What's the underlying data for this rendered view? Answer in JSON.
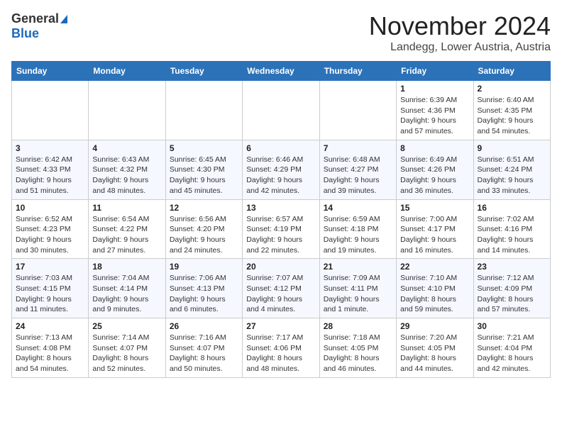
{
  "header": {
    "logo_general": "General",
    "logo_blue": "Blue",
    "month": "November 2024",
    "location": "Landegg, Lower Austria, Austria"
  },
  "weekdays": [
    "Sunday",
    "Monday",
    "Tuesday",
    "Wednesday",
    "Thursday",
    "Friday",
    "Saturday"
  ],
  "weeks": [
    [
      {
        "day": "",
        "info": ""
      },
      {
        "day": "",
        "info": ""
      },
      {
        "day": "",
        "info": ""
      },
      {
        "day": "",
        "info": ""
      },
      {
        "day": "",
        "info": ""
      },
      {
        "day": "1",
        "info": "Sunrise: 6:39 AM\nSunset: 4:36 PM\nDaylight: 9 hours and 57 minutes."
      },
      {
        "day": "2",
        "info": "Sunrise: 6:40 AM\nSunset: 4:35 PM\nDaylight: 9 hours and 54 minutes."
      }
    ],
    [
      {
        "day": "3",
        "info": "Sunrise: 6:42 AM\nSunset: 4:33 PM\nDaylight: 9 hours and 51 minutes."
      },
      {
        "day": "4",
        "info": "Sunrise: 6:43 AM\nSunset: 4:32 PM\nDaylight: 9 hours and 48 minutes."
      },
      {
        "day": "5",
        "info": "Sunrise: 6:45 AM\nSunset: 4:30 PM\nDaylight: 9 hours and 45 minutes."
      },
      {
        "day": "6",
        "info": "Sunrise: 6:46 AM\nSunset: 4:29 PM\nDaylight: 9 hours and 42 minutes."
      },
      {
        "day": "7",
        "info": "Sunrise: 6:48 AM\nSunset: 4:27 PM\nDaylight: 9 hours and 39 minutes."
      },
      {
        "day": "8",
        "info": "Sunrise: 6:49 AM\nSunset: 4:26 PM\nDaylight: 9 hours and 36 minutes."
      },
      {
        "day": "9",
        "info": "Sunrise: 6:51 AM\nSunset: 4:24 PM\nDaylight: 9 hours and 33 minutes."
      }
    ],
    [
      {
        "day": "10",
        "info": "Sunrise: 6:52 AM\nSunset: 4:23 PM\nDaylight: 9 hours and 30 minutes."
      },
      {
        "day": "11",
        "info": "Sunrise: 6:54 AM\nSunset: 4:22 PM\nDaylight: 9 hours and 27 minutes."
      },
      {
        "day": "12",
        "info": "Sunrise: 6:56 AM\nSunset: 4:20 PM\nDaylight: 9 hours and 24 minutes."
      },
      {
        "day": "13",
        "info": "Sunrise: 6:57 AM\nSunset: 4:19 PM\nDaylight: 9 hours and 22 minutes."
      },
      {
        "day": "14",
        "info": "Sunrise: 6:59 AM\nSunset: 4:18 PM\nDaylight: 9 hours and 19 minutes."
      },
      {
        "day": "15",
        "info": "Sunrise: 7:00 AM\nSunset: 4:17 PM\nDaylight: 9 hours and 16 minutes."
      },
      {
        "day": "16",
        "info": "Sunrise: 7:02 AM\nSunset: 4:16 PM\nDaylight: 9 hours and 14 minutes."
      }
    ],
    [
      {
        "day": "17",
        "info": "Sunrise: 7:03 AM\nSunset: 4:15 PM\nDaylight: 9 hours and 11 minutes."
      },
      {
        "day": "18",
        "info": "Sunrise: 7:04 AM\nSunset: 4:14 PM\nDaylight: 9 hours and 9 minutes."
      },
      {
        "day": "19",
        "info": "Sunrise: 7:06 AM\nSunset: 4:13 PM\nDaylight: 9 hours and 6 minutes."
      },
      {
        "day": "20",
        "info": "Sunrise: 7:07 AM\nSunset: 4:12 PM\nDaylight: 9 hours and 4 minutes."
      },
      {
        "day": "21",
        "info": "Sunrise: 7:09 AM\nSunset: 4:11 PM\nDaylight: 9 hours and 1 minute."
      },
      {
        "day": "22",
        "info": "Sunrise: 7:10 AM\nSunset: 4:10 PM\nDaylight: 8 hours and 59 minutes."
      },
      {
        "day": "23",
        "info": "Sunrise: 7:12 AM\nSunset: 4:09 PM\nDaylight: 8 hours and 57 minutes."
      }
    ],
    [
      {
        "day": "24",
        "info": "Sunrise: 7:13 AM\nSunset: 4:08 PM\nDaylight: 8 hours and 54 minutes."
      },
      {
        "day": "25",
        "info": "Sunrise: 7:14 AM\nSunset: 4:07 PM\nDaylight: 8 hours and 52 minutes."
      },
      {
        "day": "26",
        "info": "Sunrise: 7:16 AM\nSunset: 4:07 PM\nDaylight: 8 hours and 50 minutes."
      },
      {
        "day": "27",
        "info": "Sunrise: 7:17 AM\nSunset: 4:06 PM\nDaylight: 8 hours and 48 minutes."
      },
      {
        "day": "28",
        "info": "Sunrise: 7:18 AM\nSunset: 4:05 PM\nDaylight: 8 hours and 46 minutes."
      },
      {
        "day": "29",
        "info": "Sunrise: 7:20 AM\nSunset: 4:05 PM\nDaylight: 8 hours and 44 minutes."
      },
      {
        "day": "30",
        "info": "Sunrise: 7:21 AM\nSunset: 4:04 PM\nDaylight: 8 hours and 42 minutes."
      }
    ]
  ]
}
